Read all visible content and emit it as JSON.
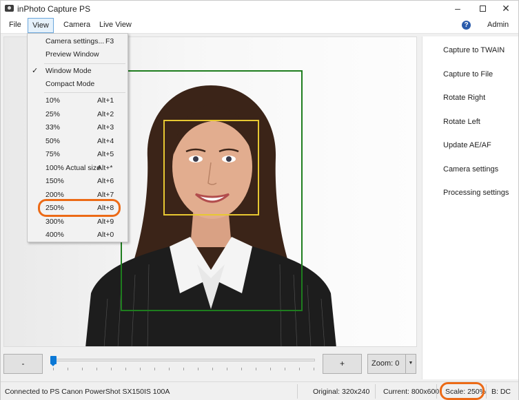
{
  "window": {
    "title": "inPhoto Capture PS"
  },
  "menubar": {
    "file": "File",
    "view": "View",
    "camera": "Camera",
    "live_view": "Live View",
    "help_icon_glyph": "?",
    "admin": "Admin"
  },
  "view_menu": {
    "items": [
      {
        "label": "Camera settings...",
        "shortcut": "F3",
        "checked": false
      },
      {
        "label": "Preview Window",
        "shortcut": "",
        "checked": false
      },
      {
        "label": "Window Mode",
        "shortcut": "",
        "checked": true
      },
      {
        "label": "Compact Mode",
        "shortcut": "",
        "checked": false
      },
      {
        "label": "10%",
        "shortcut": "Alt+1",
        "checked": false
      },
      {
        "label": "25%",
        "shortcut": "Alt+2",
        "checked": false
      },
      {
        "label": "33%",
        "shortcut": "Alt+3",
        "checked": false
      },
      {
        "label": "50%",
        "shortcut": "Alt+4",
        "checked": false
      },
      {
        "label": "75%",
        "shortcut": "Alt+5",
        "checked": false
      },
      {
        "label": "100% Actual size",
        "shortcut": "Alt+*",
        "checked": false
      },
      {
        "label": "150%",
        "shortcut": "Alt+6",
        "checked": false
      },
      {
        "label": "200%",
        "shortcut": "Alt+7",
        "checked": false
      },
      {
        "label": "250%",
        "shortcut": "Alt+8",
        "checked": false
      },
      {
        "label": "300%",
        "shortcut": "Alt+9",
        "checked": false
      },
      {
        "label": "400%",
        "shortcut": "Alt+0",
        "checked": false
      }
    ],
    "check_glyph": "✓"
  },
  "side_panel": {
    "capture_twain": "Capture to TWAIN",
    "capture_file": "Capture to File",
    "rotate_right": "Rotate Right",
    "rotate_left": "Rotate Left",
    "update_ae_af": "Update AE/AF",
    "camera_settings": "Camera settings",
    "processing_settings": "Processing settings"
  },
  "controls": {
    "minus_label": "-",
    "plus_label": "+",
    "zoom_label": "Zoom: 0",
    "zoom_slider_level": 0.0
  },
  "status": {
    "connection": "Connected to PS Canon PowerShot SX150IS 100A",
    "original": "Original: 320x240",
    "current": "Current: 800x600",
    "scale": "Scale: 250%",
    "b": "B: DC"
  },
  "colors": {
    "face_frame": "#1e7d1e",
    "eye_frame": "#e7c832",
    "highlight": "#ec6a16",
    "accent": "#0b78d6"
  }
}
